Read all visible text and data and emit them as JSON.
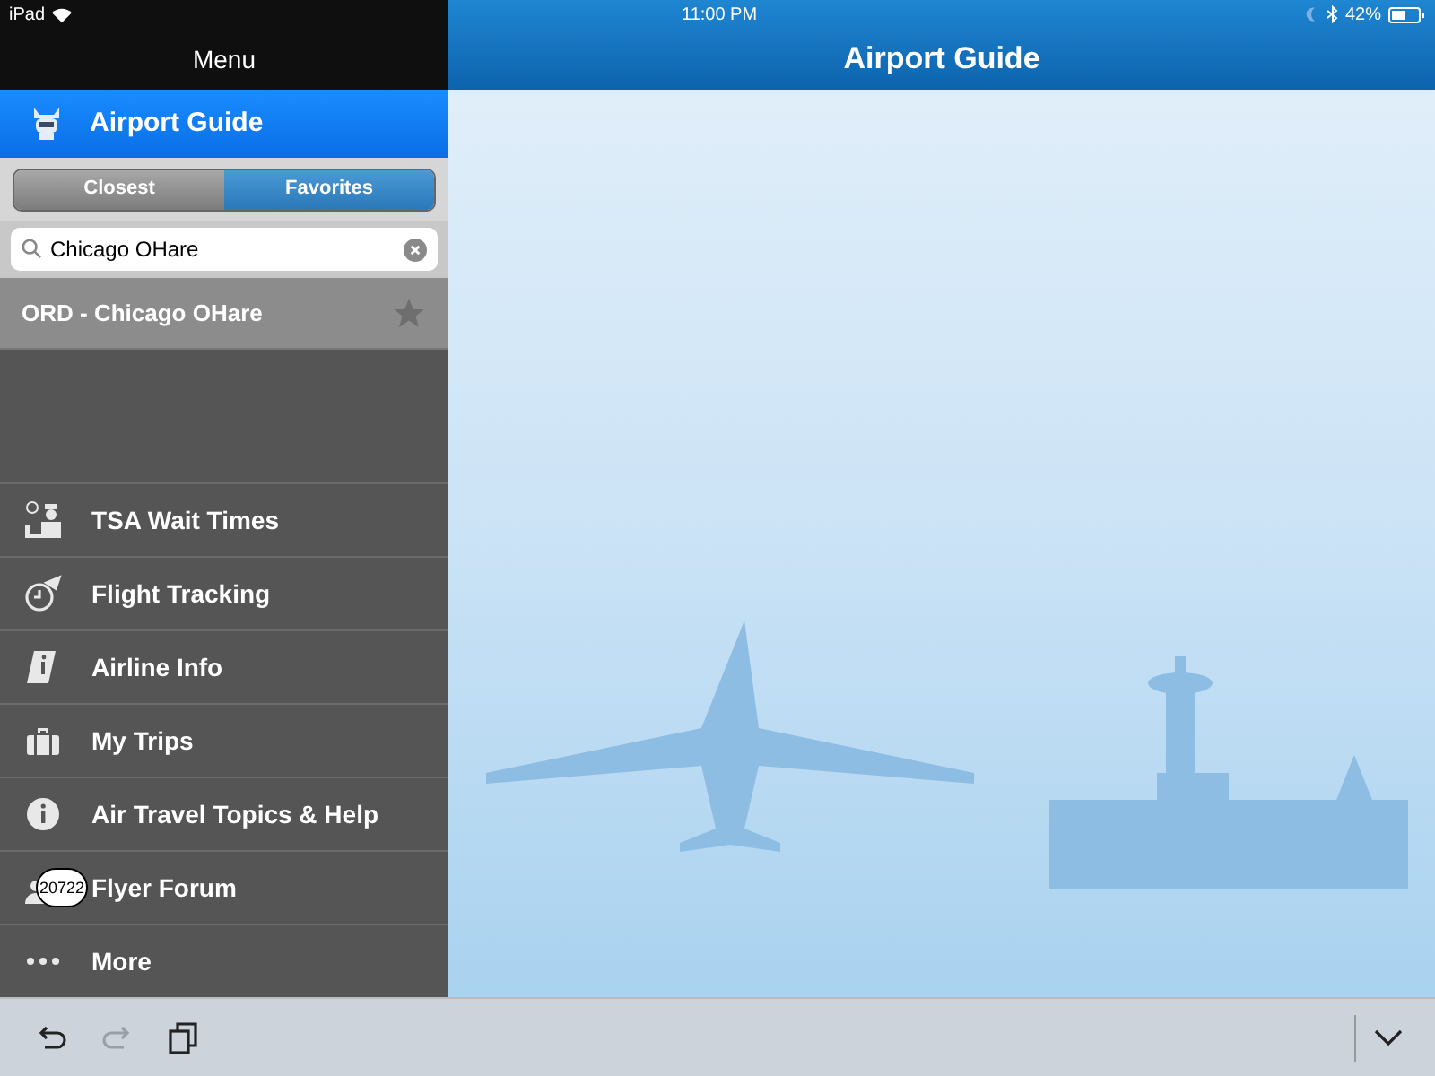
{
  "status_bar": {
    "device": "iPad",
    "time": "11:00 PM",
    "battery": "42%"
  },
  "sidebar": {
    "title": "Menu",
    "app": {
      "label": "Airport Guide"
    },
    "segments": [
      {
        "label": "Closest",
        "selected": false
      },
      {
        "label": "Favorites",
        "selected": true
      }
    ],
    "search": {
      "value": "Chicago OHare"
    },
    "results": [
      {
        "label": "ORD - Chicago OHare",
        "favorite": false
      }
    ],
    "items": [
      {
        "kind": "tsa",
        "label": "TSA Wait Times"
      },
      {
        "kind": "flight",
        "label": "Flight Tracking"
      },
      {
        "kind": "airline",
        "label": "Airline Info"
      },
      {
        "kind": "trips",
        "label": "My Trips"
      },
      {
        "kind": "info",
        "label": "Air Travel Topics & Help"
      },
      {
        "kind": "forum",
        "label": "Flyer Forum",
        "badge": "20722"
      },
      {
        "kind": "more",
        "label": "More"
      }
    ]
  },
  "main": {
    "title": "Airport Guide"
  },
  "toolbar": {
    "undo": {
      "disabled": false
    },
    "redo": {
      "disabled": true
    }
  }
}
